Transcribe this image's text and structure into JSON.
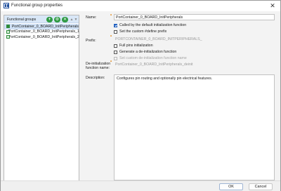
{
  "window": {
    "title": "Functional group properties",
    "icon": "app-icon",
    "close_glyph": "✕"
  },
  "functional_groups": {
    "header": "Functional groups",
    "toolbar": {
      "add_glyph": "+",
      "gear_glyph": "⚙",
      "remove_glyph": "✕",
      "up_glyph": "▲",
      "down_glyph": "▼"
    },
    "items": [
      {
        "label": "PortContainer_0_BOARD_InitPeripherals",
        "selected": true
      },
      {
        "label": "PortContainer_0_BOARD_InitPeripherals_1",
        "selected": false
      },
      {
        "label": "PortContainer_0_BOARD_InitPeripherals_2",
        "selected": false
      }
    ]
  },
  "form": {
    "name_label": "Name:",
    "name_value": "PortContainer_0_BOARD_InitPeripherals",
    "called_by_default_label": "Called by the default initialization function",
    "called_by_default_checked": true,
    "custom_define_label": "Set the custom #define prefix",
    "custom_define_checked": false,
    "prefix_label": "Prefix:",
    "prefix_value": "PORTCONTAINER_0_BOARD_INITPERIPHERALS_",
    "full_pins_label": "Full pins initialization",
    "full_pins_checked": false,
    "generate_deinit_label": "Generate a de-initialization function",
    "generate_deinit_checked": false,
    "custom_deinit_name_label": "Set custom de-initialization function name",
    "custom_deinit_name_checked": false,
    "deinit_label_line1": "De-initialization",
    "deinit_label_line2": "function name:",
    "deinit_value": "PortContainer_0_BOARD_InitPeripherals_deinit",
    "description_label": "Description:",
    "description_value": "Configures pin routing and optionally pin electrical features."
  },
  "buttons": {
    "ok": "OK",
    "cancel": "Cancel"
  },
  "colors": {
    "accent": "#1f5fbf",
    "list_selection": "#cfe0f4",
    "toolbar_green": "#2f9a44",
    "required_marker": "#e0891a"
  }
}
